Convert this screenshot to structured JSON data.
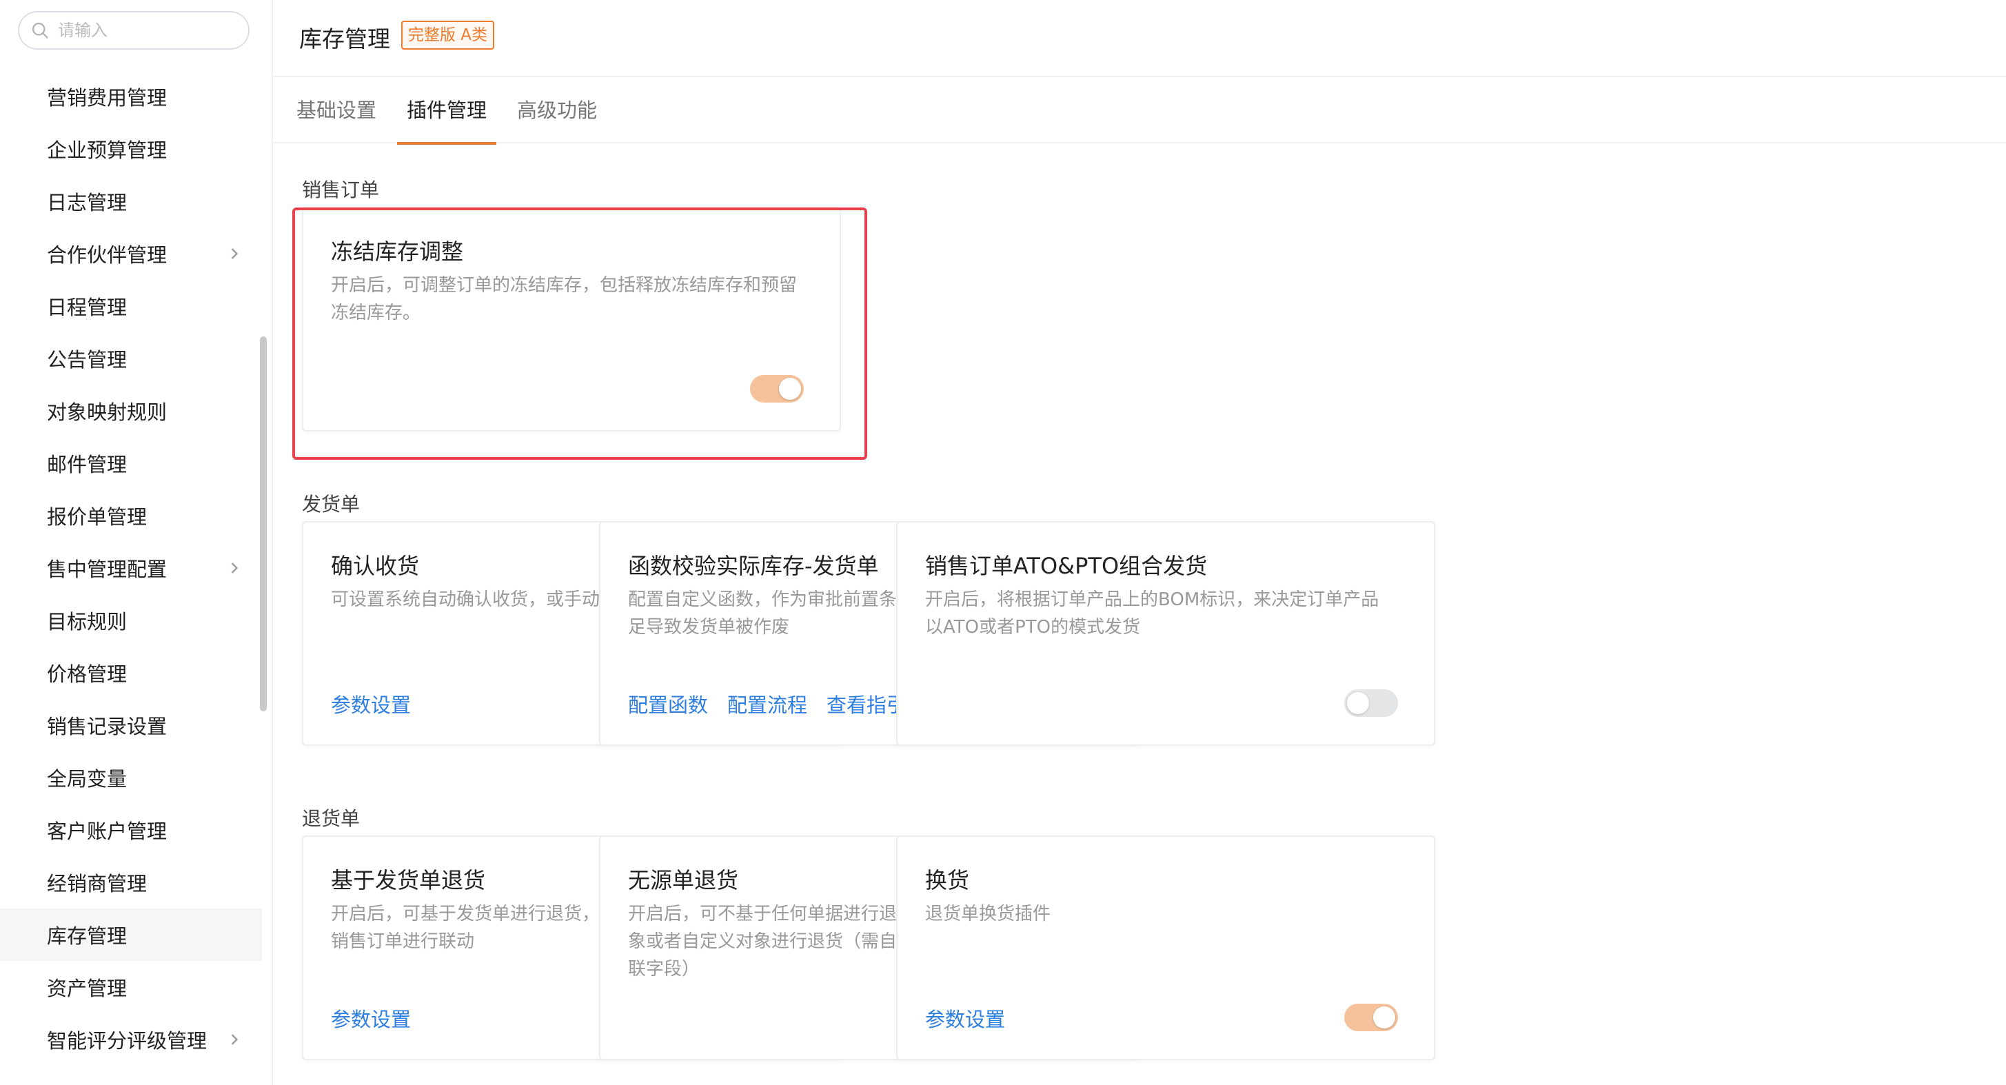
{
  "search": {
    "placeholder": "请输入"
  },
  "sidebar": {
    "items": [
      {
        "label": "营销费用管理",
        "has_children": false
      },
      {
        "label": "企业预算管理",
        "has_children": false
      },
      {
        "label": "日志管理",
        "has_children": false
      },
      {
        "label": "合作伙伴管理",
        "has_children": true
      },
      {
        "label": "日程管理",
        "has_children": false
      },
      {
        "label": "公告管理",
        "has_children": false
      },
      {
        "label": "对象映射规则",
        "has_children": false
      },
      {
        "label": "邮件管理",
        "has_children": false
      },
      {
        "label": "报价单管理",
        "has_children": false
      },
      {
        "label": "售中管理配置",
        "has_children": true
      },
      {
        "label": "目标规则",
        "has_children": false
      },
      {
        "label": "价格管理",
        "has_children": false
      },
      {
        "label": "销售记录设置",
        "has_children": false
      },
      {
        "label": "全局变量",
        "has_children": false
      },
      {
        "label": "客户账户管理",
        "has_children": false
      },
      {
        "label": "经销商管理",
        "has_children": false
      },
      {
        "label": "库存管理",
        "has_children": false,
        "active": true
      },
      {
        "label": "资产管理",
        "has_children": false
      },
      {
        "label": "智能评分评级管理",
        "has_children": true
      }
    ]
  },
  "header": {
    "title": "库存管理",
    "badge": "完整版 A类"
  },
  "tabs": [
    {
      "label": "基础设置",
      "active": false
    },
    {
      "label": "插件管理",
      "active": true
    },
    {
      "label": "高级功能",
      "active": false
    }
  ],
  "sections": [
    {
      "title": "销售订单",
      "cards": [
        {
          "title": "冻结库存调整",
          "desc": "开启后，可调整订单的冻结库存，包括释放冻结库存和预留冻结库存。",
          "links": [],
          "toggle": "on-disabled"
        }
      ]
    },
    {
      "title": "发货单",
      "cards": [
        {
          "title": "确认收货",
          "desc": "可设置系统自动确认收货，或手动收货时必须电子签名",
          "links": [
            "参数设置"
          ],
          "toggle": "on"
        },
        {
          "title": "函数校验实际库存-发货单",
          "desc": "配置自定义函数，作为审批前置条件校验，避免实际库存不足导致发货单被作废",
          "links": [
            "配置函数",
            "配置流程",
            "查看指引"
          ],
          "toggle": null
        },
        {
          "title": "销售订单ATO&PTO组合发货",
          "desc": "开启后，将根据订单产品上的BOM标识，来决定订单产品以ATO或者PTO的模式发货",
          "links": [],
          "toggle": "off"
        }
      ]
    },
    {
      "title": "退货单",
      "cards": [
        {
          "title": "基于发货单退货",
          "desc": "开启后，可基于发货单进行退货，退货单将同时与发货单、销售订单进行联动",
          "links": [
            "参数设置"
          ],
          "toggle": "on-disabled"
        },
        {
          "title": "无源单退货",
          "desc": "开启后，可不基于任何单据进行退货，也可基于其他预设对象或者自定义对象进行退货（需自行添加相关对象的查找关联字段）",
          "links": [],
          "toggle": "on-disabled"
        },
        {
          "title": "换货",
          "desc": "退货单换货插件",
          "links": [
            "参数设置"
          ],
          "toggle": "on-disabled"
        }
      ]
    }
  ],
  "colors": {
    "accent": "#ee7b2e",
    "link": "#2f7fe0",
    "highlight": "#e5424d"
  }
}
